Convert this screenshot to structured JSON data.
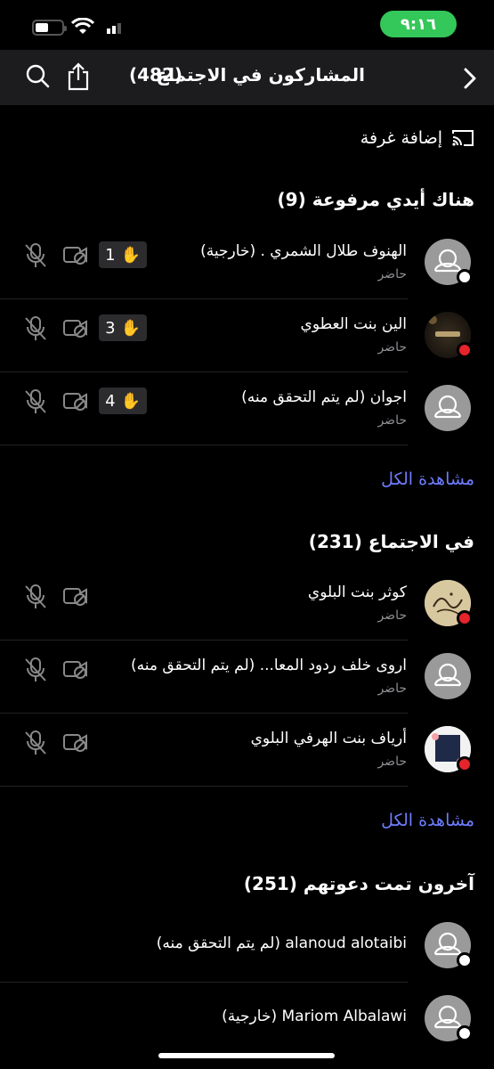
{
  "status_bar": {
    "time": "٩:١٦"
  },
  "nav": {
    "title": "المشاركون في الاجتماع",
    "count": "(482)"
  },
  "add_room": {
    "label": "إضافة غرفة"
  },
  "raised_hands": {
    "title": "هناك أيدي مرفوعة (9)",
    "rows": [
      {
        "name": "الهنوف طلال الشمري . (خارجية)",
        "status": "حاضر",
        "hand_order": "1"
      },
      {
        "name": "الين بنت العطوي",
        "status": "حاضر",
        "hand_order": "3"
      },
      {
        "name": "اجوان (لم يتم التحقق منه)",
        "status": "حاضر",
        "hand_order": "4"
      }
    ],
    "see_all": "مشاهدة الكل"
  },
  "in_meeting": {
    "title": "في الاجتماع (231)",
    "rows": [
      {
        "name": "كوثر بنت البلوي",
        "status": "حاضر"
      },
      {
        "name": "اروى خلف ردود المعا...  (لم يتم التحقق منه)",
        "status": "حاضر"
      },
      {
        "name": "أرياف بنت الهرفي البلوي",
        "status": "حاضر"
      }
    ],
    "see_all": "مشاهدة الكل"
  },
  "invited": {
    "title": "آخرون تمت دعوتهم (251)",
    "rows": [
      {
        "name": "alanoud alotaibi (لم يتم التحقق منه)"
      },
      {
        "name": "Mariom Albalawi (خارجية)"
      }
    ]
  },
  "colors": {
    "accent": "#6f7dff",
    "battery_pill": "#34c759",
    "away": "#e5242b"
  }
}
